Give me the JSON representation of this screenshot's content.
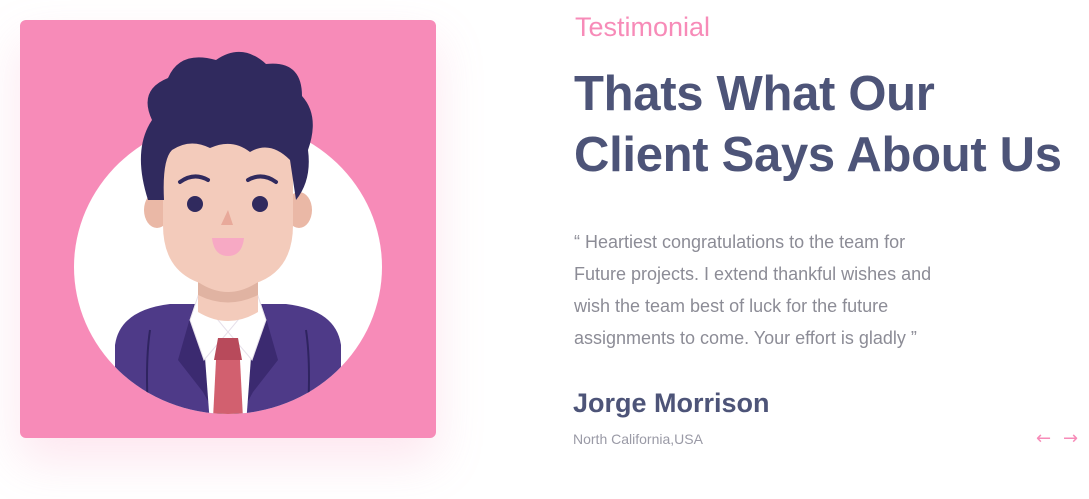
{
  "section": {
    "eyebrow": "Testimonial",
    "heading_line1": "Thats What Our",
    "heading_line2": "Client Says About Us"
  },
  "testimonial": {
    "quote_lines": [
      "“ Heartiest congratulations to the team for",
      "Future projects. I extend thankful wishes and",
      "wish the team best of luck for the future",
      "assignments to come. Your effort is gladly ”"
    ],
    "client_name": "Jorge Morrison",
    "client_location": "North California,USA"
  },
  "nav": {
    "prev_icon": "arrow-left-icon",
    "prev_glyph": "←",
    "next_icon": "arrow-right-icon",
    "next_glyph": "→"
  },
  "colors": {
    "accent_pink": "#f78bb8",
    "heading": "#4d5478",
    "body_text": "#8c8c96",
    "hair": "#302a5e",
    "suit": "#4e3a88",
    "tie": "#d2606f",
    "skin": "#f3cbbb"
  }
}
